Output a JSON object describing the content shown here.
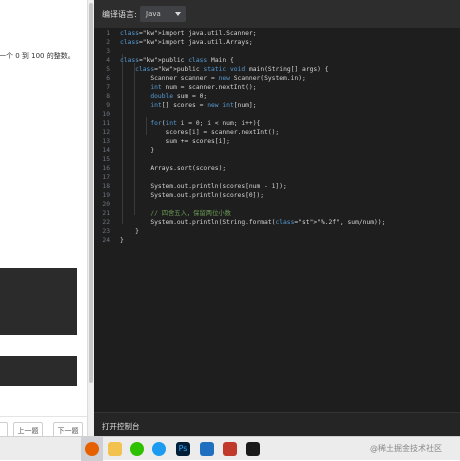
{
  "problem_panel": {
    "text_fragment": "一个 0 到 100 的整数。",
    "pager": {
      "partial_label": "",
      "prev_label": "上一题",
      "next_label": "下一题"
    }
  },
  "editor": {
    "language_label": "编译语言:",
    "language_value": "Java",
    "console_label": "打开控制台",
    "code_lines": [
      {
        "n": "1",
        "t": "import java.util.Scanner;"
      },
      {
        "n": "2",
        "t": "import java.util.Arrays;"
      },
      {
        "n": "3",
        "t": ""
      },
      {
        "n": "4",
        "t": "public class Main {"
      },
      {
        "n": "5",
        "t": "    public static void main(String[] args) {"
      },
      {
        "n": "6",
        "t": "        Scanner scanner = new Scanner(System.in);"
      },
      {
        "n": "7",
        "t": "        int num = scanner.nextInt();"
      },
      {
        "n": "8",
        "t": "        double sum = 0;"
      },
      {
        "n": "9",
        "t": "        int[] scores = new int[num];"
      },
      {
        "n": "10",
        "t": ""
      },
      {
        "n": "11",
        "t": "        for(int i = 0; i < num; i++){"
      },
      {
        "n": "12",
        "t": "            scores[i] = scanner.nextInt();"
      },
      {
        "n": "13",
        "t": "            sum += scores[i];"
      },
      {
        "n": "14",
        "t": "        }"
      },
      {
        "n": "15",
        "t": ""
      },
      {
        "n": "16",
        "t": "        Arrays.sort(scores);"
      },
      {
        "n": "17",
        "t": ""
      },
      {
        "n": "18",
        "t": "        System.out.println(scores[num - 1]);"
      },
      {
        "n": "19",
        "t": "        System.out.println(scores[0]);"
      },
      {
        "n": "20",
        "t": ""
      },
      {
        "n": "21",
        "t": "        // 四舍五入，保留两位小数"
      },
      {
        "n": "22",
        "t": "        System.out.println(String.format(\"%.2f\", sum/num));"
      },
      {
        "n": "23",
        "t": "    }"
      },
      {
        "n": "24",
        "t": "}"
      }
    ]
  },
  "taskbar": {
    "icons": [
      "firefox-icon",
      "folder-icon",
      "wechat-icon",
      "qq-icon",
      "photoshop-icon",
      "vscode-icon",
      "ide-icon",
      "terminal-icon"
    ],
    "watermark": "@稀土掘金技术社区"
  },
  "colors": {
    "editor_bg": "#1e1e1e",
    "keyword": "#569cd6",
    "comment": "#6a9955",
    "string": "#ce9178"
  }
}
